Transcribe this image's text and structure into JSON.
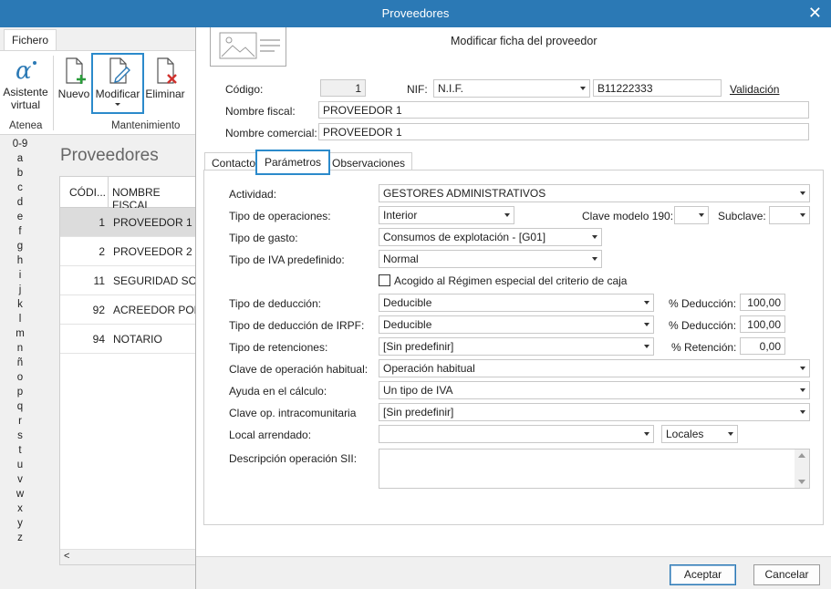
{
  "window": {
    "title": "Proveedores",
    "close_symbol": "✕"
  },
  "ribbon": {
    "tab": "Fichero",
    "buttons": {
      "asistente": "Asistente virtual",
      "nuevo": "Nuevo",
      "modificar": "Modificar",
      "eliminar": "Eliminar"
    },
    "groups": {
      "atenea": "Atenea",
      "mantenimiento": "Mantenimiento"
    }
  },
  "alphabet": [
    "0-9",
    "a",
    "b",
    "c",
    "d",
    "e",
    "f",
    "g",
    "h",
    "i",
    "j",
    "k",
    "l",
    "m",
    "n",
    "ñ",
    "o",
    "p",
    "q",
    "r",
    "s",
    "t",
    "u",
    "v",
    "w",
    "x",
    "y",
    "z"
  ],
  "list": {
    "title": "Proveedores",
    "headers": {
      "code": "CÓDI...",
      "name": "NOMBRE FISCAL"
    },
    "rows": [
      {
        "code": "1",
        "name": "PROVEEDOR 1",
        "selected": true
      },
      {
        "code": "2",
        "name": "PROVEEDOR 2",
        "selected": false
      },
      {
        "code": "11",
        "name": "SEGURIDAD SOCI",
        "selected": false
      },
      {
        "code": "92",
        "name": "ACREEDOR POR A",
        "selected": false
      },
      {
        "code": "94",
        "name": "NOTARIO",
        "selected": false
      }
    ],
    "scroll_left": "<"
  },
  "dialog": {
    "heading": "Modificar ficha del proveedor",
    "codigo_label": "Código:",
    "codigo_value": "1",
    "nif_label": "NIF:",
    "nif_type": "N.I.F.",
    "nif_value": "B11222333",
    "validacion": "Validación",
    "nombre_fiscal_label": "Nombre fiscal:",
    "nombre_fiscal_value": "PROVEEDOR 1",
    "nombre_comercial_label": "Nombre comercial:",
    "nombre_comercial_value": "PROVEEDOR 1",
    "tabs": [
      "Contacto",
      "Parámetros",
      "Observaciones"
    ],
    "active_tab": "Parámetros",
    "params": {
      "actividad": {
        "label": "Actividad:",
        "value": "GESTORES ADMINISTRATIVOS"
      },
      "tipo_operaciones": {
        "label": "Tipo de operaciones:",
        "value": "Interior"
      },
      "clave_modelo": {
        "label": "Clave modelo 190:",
        "value": ""
      },
      "subclave": {
        "label": "Subclave:",
        "value": ""
      },
      "tipo_gasto": {
        "label": "Tipo de gasto:",
        "value": "Consumos de explotación - [G01]"
      },
      "tipo_iva": {
        "label": "Tipo de IVA predefinido:",
        "value": "Normal"
      },
      "acogido": {
        "label": "Acogido al Régimen especial del criterio de caja",
        "checked": false
      },
      "tipo_deduccion": {
        "label": "Tipo de deducción:",
        "value": "Deducible",
        "pct_label": "% Deducción:",
        "pct_value": "100,00"
      },
      "tipo_deduccion_irpf": {
        "label": "Tipo de deducción de IRPF:",
        "value": "Deducible",
        "pct_label": "% Deducción:",
        "pct_value": "100,00"
      },
      "tipo_retenciones": {
        "label": "Tipo de retenciones:",
        "value": "[Sin predefinir]",
        "pct_label": "% Retención:",
        "pct_value": "0,00"
      },
      "clave_operacion": {
        "label": "Clave de operación habitual:",
        "value": "Operación habitual"
      },
      "ayuda_calculo": {
        "label": "Ayuda en el cálculo:",
        "value": "Un tipo de IVA"
      },
      "clave_intra": {
        "label": "Clave op. intracomunitaria",
        "value": "[Sin predefinir]"
      },
      "local_arrendado": {
        "label": "Local arrendado:",
        "value": "",
        "button": "Locales"
      },
      "descripcion_sii": {
        "label": "Descripción operación SII:",
        "value": ""
      }
    },
    "buttons": {
      "aceptar": "Aceptar",
      "cancelar": "Cancelar"
    }
  },
  "colors": {
    "titlebar": "#2b79b5",
    "focus": "#2b8acb",
    "selected_row": "#dcdcdc"
  }
}
